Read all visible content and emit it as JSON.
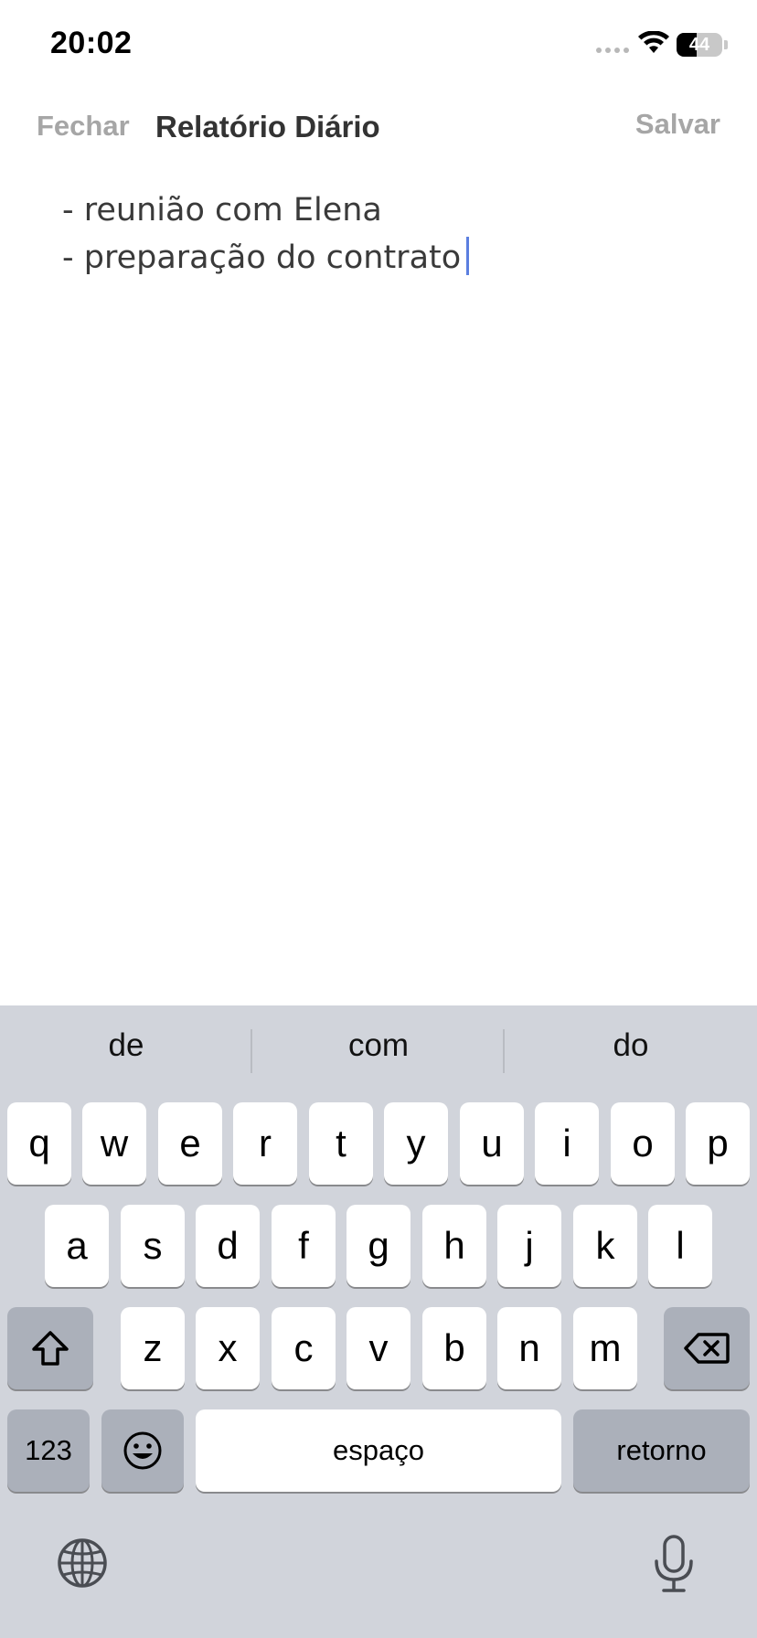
{
  "status_bar": {
    "time": "20:02",
    "battery_level": "44"
  },
  "nav": {
    "close_label": "Fechar",
    "title": "Relatório Diário",
    "save_label": "Salvar"
  },
  "editor": {
    "lines": [
      "- reunião com Elena",
      "- preparação do contrato"
    ]
  },
  "keyboard": {
    "suggestions": [
      "de",
      "com",
      "do"
    ],
    "row1": [
      "q",
      "w",
      "e",
      "r",
      "t",
      "y",
      "u",
      "i",
      "o",
      "p"
    ],
    "row2": [
      "a",
      "s",
      "d",
      "f",
      "g",
      "h",
      "j",
      "k",
      "l"
    ],
    "row3": [
      "z",
      "x",
      "c",
      "v",
      "b",
      "n",
      "m"
    ],
    "numbers_label": "123",
    "space_label": "espaço",
    "return_label": "retorno"
  },
  "icons": {
    "shift": "shift-icon",
    "backspace": "backspace-icon",
    "emoji": "emoji-icon",
    "globe": "globe-icon",
    "microphone": "microphone-icon",
    "wifi": "wifi-icon"
  },
  "colors": {
    "keyboard_bg": "#d1d4db",
    "key_bg": "#ffffff",
    "key_dark_bg": "#abb0ba",
    "caret": "#5b7fe0",
    "nav_button": "#a6a6a6"
  }
}
